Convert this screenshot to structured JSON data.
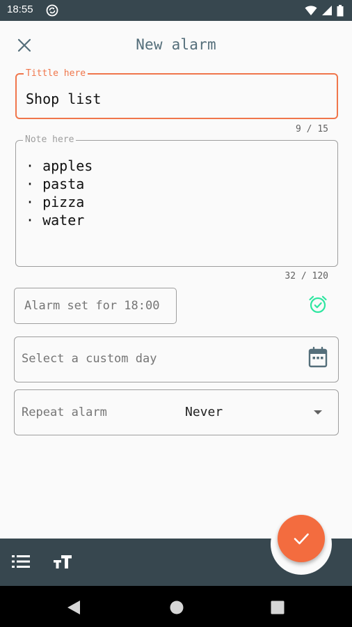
{
  "status_bar": {
    "time": "18:55",
    "icons": [
      "sync-icon",
      "wifi-icon",
      "signal-icon",
      "battery-icon"
    ]
  },
  "app_bar": {
    "title": "New alarm",
    "close_icon": "close-icon"
  },
  "title_field": {
    "label": "Tittle here",
    "value": "Shop list",
    "counter": "9 / 15",
    "accent_color": "#f0764b"
  },
  "note_field": {
    "label": "Note here",
    "lines": [
      "· apples",
      "· pasta",
      "· pizza",
      "· water"
    ],
    "counter": "32 / 120"
  },
  "alarm": {
    "button_label": "Alarm set for 18:00",
    "icon": "alarm-clock-icon",
    "icon_color": "#2ee6a0"
  },
  "custom_day": {
    "placeholder": "Select a custom day",
    "icon": "calendar-icon"
  },
  "repeat": {
    "label": "Repeat alarm",
    "value": "Never",
    "icon": "dropdown-arrow-icon"
  },
  "bottom_bar": {
    "icons": [
      "list-icon",
      "text-size-icon"
    ],
    "fab_icon": "check-icon",
    "fab_color": "#f36c3f",
    "bar_color": "#37474f"
  },
  "nav_bar": {
    "icons": [
      "back-icon",
      "home-icon",
      "recents-icon"
    ]
  }
}
